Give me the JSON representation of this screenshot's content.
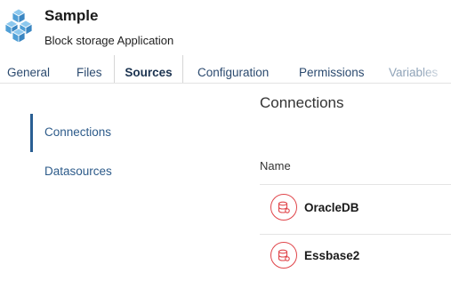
{
  "app": {
    "title": "Sample",
    "subtitle": "Block storage Application",
    "icon": "cubes-icon"
  },
  "tabs": [
    {
      "label": "General",
      "active": false
    },
    {
      "label": "Files",
      "active": false
    },
    {
      "label": "Sources",
      "active": true
    },
    {
      "label": "Configuration",
      "active": false
    },
    {
      "label": "Permissions",
      "active": false
    },
    {
      "label": "Variables",
      "active": false
    }
  ],
  "sidebar": {
    "items": [
      {
        "label": "Connections",
        "selected": true
      },
      {
        "label": "Datasources",
        "selected": false
      }
    ]
  },
  "main": {
    "title": "Connections",
    "column_header": "Name",
    "connections": [
      {
        "name": "OracleDB",
        "icon": "database-icon"
      },
      {
        "name": "Essbase2",
        "icon": "database-icon"
      }
    ]
  },
  "colors": {
    "accent": "#2a5f93",
    "link": "#2d5b8a",
    "db_icon": "#e0454a",
    "cube": "#5aa9dc"
  }
}
